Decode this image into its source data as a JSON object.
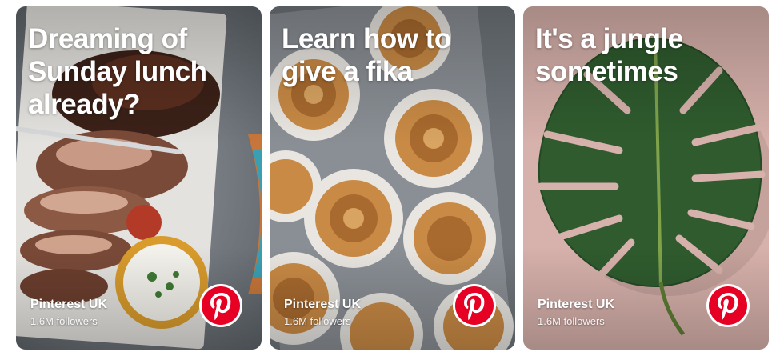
{
  "cards": [
    {
      "title": "Dreaming of\nSunday lunch\nalready?",
      "profile_name": "Pinterest UK",
      "followers": "1.6M followers",
      "logo_icon": "pinterest-icon"
    },
    {
      "title": "Learn how to\ngive a fika",
      "profile_name": "Pinterest UK",
      "followers": "1.6M followers",
      "logo_icon": "pinterest-icon"
    },
    {
      "title": "It's a jungle\nsometimes",
      "profile_name": "Pinterest UK",
      "followers": "1.6M followers",
      "logo_icon": "pinterest-icon"
    }
  ],
  "colors": {
    "brand_red": "#e60023",
    "card3_background": "#d7b1ab",
    "card2_tray": "#8a8f95"
  }
}
